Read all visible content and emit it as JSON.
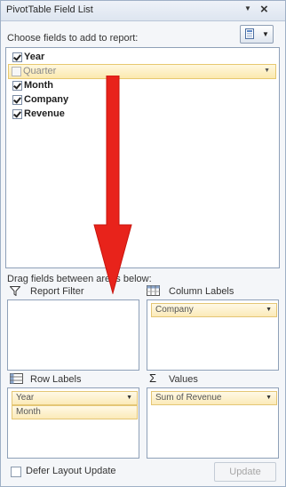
{
  "panel": {
    "title": "PivotTable Field List",
    "choose_label": "Choose fields to add to report:"
  },
  "fields": [
    {
      "name": "Year",
      "checked": true,
      "bold": true
    },
    {
      "name": "Quarter",
      "checked": false,
      "bold": false,
      "highlighted": true
    },
    {
      "name": "Month",
      "checked": true,
      "bold": true
    },
    {
      "name": "Company",
      "checked": true,
      "bold": true
    },
    {
      "name": "Revenue",
      "checked": true,
      "bold": true
    }
  ],
  "areas": {
    "drag_label": "Drag fields between areas below:",
    "report_filter": {
      "label": "Report Filter",
      "items": []
    },
    "column_labels": {
      "label": "Column Labels",
      "items": [
        "Company"
      ]
    },
    "row_labels": {
      "label": "Row Labels",
      "items": [
        "Year",
        "Month"
      ]
    },
    "values": {
      "label": "Values",
      "items": [
        "Sum of Revenue"
      ]
    }
  },
  "footer": {
    "defer_label": "Defer Layout Update",
    "update_label": "Update"
  },
  "icons": {
    "filter": "funnel-icon",
    "columns": "column-grid-icon",
    "rows": "row-grid-icon",
    "values": "sigma-icon",
    "layout": "layout-toggle-icon"
  },
  "colors": {
    "accent_arrow": "#e8231b",
    "chip_fill": "#fbeab8"
  }
}
